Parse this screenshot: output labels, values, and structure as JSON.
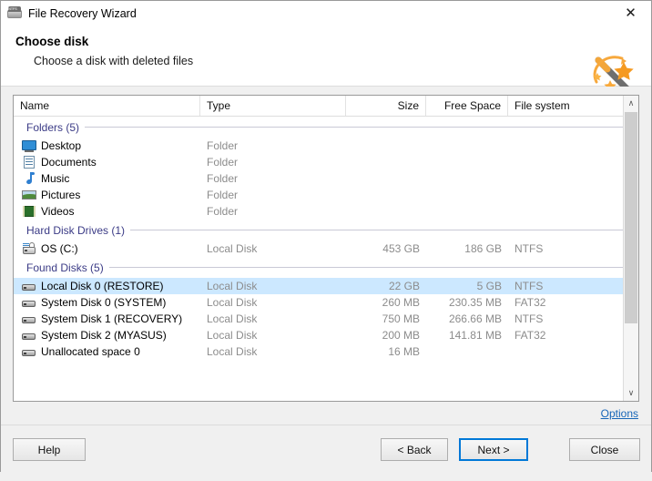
{
  "window": {
    "title": "File Recovery Wizard",
    "title_icon": "ntfs-disk-icon",
    "close_label": "✕"
  },
  "header": {
    "title": "Choose disk",
    "subtitle": "Choose a disk with deleted files",
    "logo_icon": "magic-wand-icon"
  },
  "table": {
    "columns": [
      "Name",
      "Type",
      "Size",
      "Free Space",
      "File system"
    ],
    "groups": [
      {
        "label": "Folders (5)",
        "rows": [
          {
            "icon": "desktop-icon",
            "name": "Desktop",
            "type": "Folder",
            "size": "",
            "free": "",
            "fs": "",
            "selected": false
          },
          {
            "icon": "documents-icon",
            "name": "Documents",
            "type": "Folder",
            "size": "",
            "free": "",
            "fs": "",
            "selected": false
          },
          {
            "icon": "music-icon",
            "name": "Music",
            "type": "Folder",
            "size": "",
            "free": "",
            "fs": "",
            "selected": false
          },
          {
            "icon": "pictures-icon",
            "name": "Pictures",
            "type": "Folder",
            "size": "",
            "free": "",
            "fs": "",
            "selected": false
          },
          {
            "icon": "videos-icon",
            "name": "Videos",
            "type": "Folder",
            "size": "",
            "free": "",
            "fs": "",
            "selected": false
          }
        ]
      },
      {
        "label": "Hard Disk Drives (1)",
        "rows": [
          {
            "icon": "harddrive-icon",
            "name": "OS (C:)",
            "type": "Local Disk",
            "size": "453 GB",
            "free": "186 GB",
            "fs": "NTFS",
            "selected": false
          }
        ]
      },
      {
        "label": "Found Disks (5)",
        "rows": [
          {
            "icon": "disk-icon",
            "name": "Local Disk 0 (RESTORE)",
            "type": "Local Disk",
            "size": "22 GB",
            "free": "5 GB",
            "fs": "NTFS",
            "selected": true
          },
          {
            "icon": "disk-icon",
            "name": "System Disk 0 (SYSTEM)",
            "type": "Local Disk",
            "size": "260 MB",
            "free": "230.35 MB",
            "fs": "FAT32",
            "selected": false
          },
          {
            "icon": "disk-icon",
            "name": "System Disk 1 (RECOVERY)",
            "type": "Local Disk",
            "size": "750 MB",
            "free": "266.66 MB",
            "fs": "NTFS",
            "selected": false
          },
          {
            "icon": "disk-icon",
            "name": "System Disk 2 (MYASUS)",
            "type": "Local Disk",
            "size": "200 MB",
            "free": "141.81 MB",
            "fs": "FAT32",
            "selected": false
          },
          {
            "icon": "disk-icon",
            "name": "Unallocated space 0",
            "type": "Local Disk",
            "size": "16 MB",
            "free": "",
            "fs": "",
            "selected": false
          }
        ]
      }
    ]
  },
  "scrollbar": {
    "up_arrow": "∧",
    "down_arrow": "∨"
  },
  "options": {
    "label": "Options"
  },
  "footer": {
    "help": "Help",
    "back": "< Back",
    "next": "Next >",
    "close": "Close"
  },
  "colors": {
    "selection": "#cce8ff",
    "group_header": "#3b3b86",
    "link": "#1866b8",
    "default_button_border": "#0078d7"
  }
}
